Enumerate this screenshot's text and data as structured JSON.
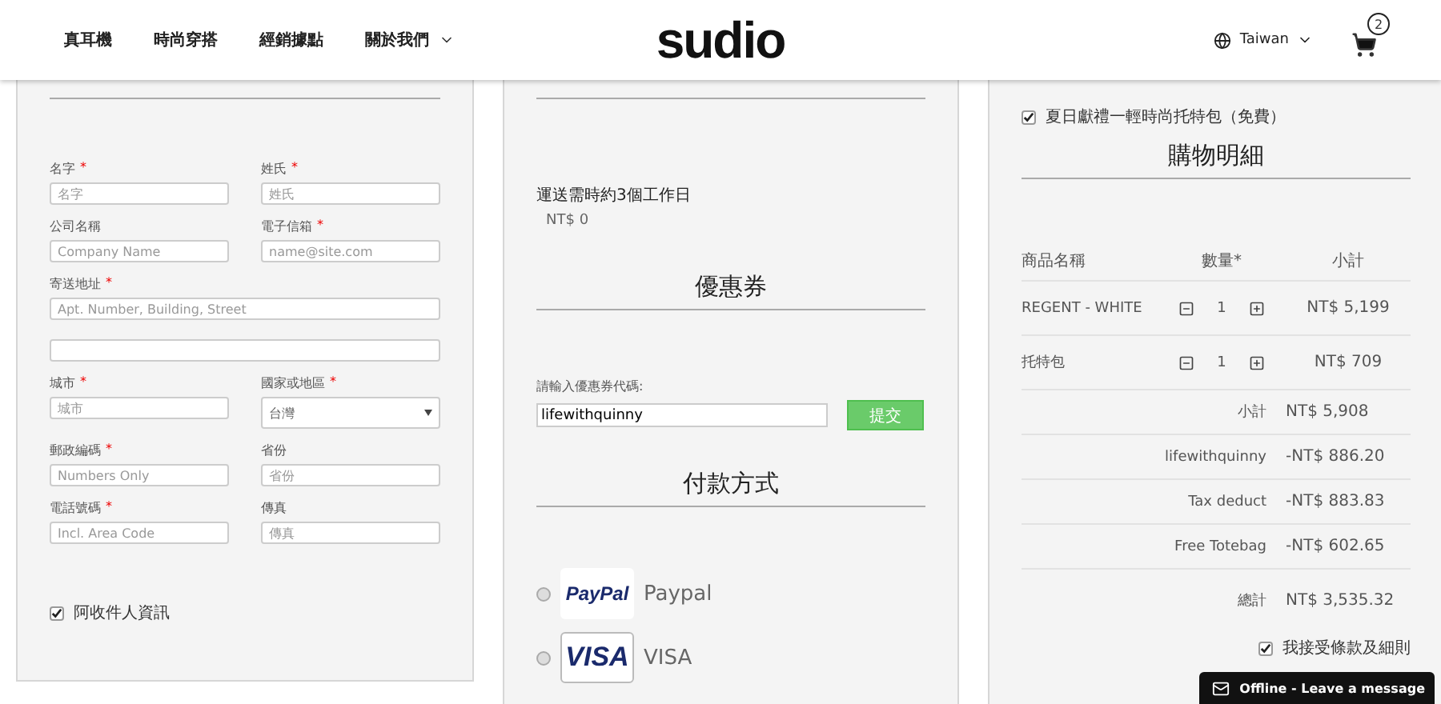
{
  "header": {
    "nav": [
      {
        "label": "真耳機",
        "dropdown": false
      },
      {
        "label": "時尚穿搭",
        "dropdown": false
      },
      {
        "label": "經銷據點",
        "dropdown": false
      },
      {
        "label": "關於我們",
        "dropdown": true
      }
    ],
    "logo": "sudio",
    "region": "Taiwan",
    "cart_count": "2"
  },
  "customer_form": {
    "fields": [
      {
        "kind": "input",
        "label": "名字",
        "marker": "*",
        "placeholder": "名字"
      },
      {
        "kind": "input",
        "label": "姓氏",
        "marker": "*",
        "placeholder": "姓氏"
      },
      {
        "kind": "input",
        "label": "公司名稱",
        "placeholder": "Company Name"
      },
      {
        "kind": "input",
        "label": "電子信箱",
        "marker": "*",
        "placeholder": "name@site.com"
      },
      {
        "kind": "wide",
        "label": "寄送地址",
        "marker": "*",
        "placeholder": "Apt. Number, Building, Street"
      },
      {
        "kind": "wide"
      },
      {
        "kind": "input",
        "label": "城市",
        "marker": "*",
        "placeholder": "城市"
      },
      {
        "kind": "select",
        "label": "國家或地區",
        "marker": "*",
        "value": "台灣"
      },
      {
        "kind": "input",
        "label": "郵政編碼",
        "marker": "*",
        "placeholder": "Numbers Only"
      },
      {
        "kind": "input",
        "label": "省份",
        "placeholder": "省份"
      },
      {
        "kind": "input",
        "label": "電話號碼",
        "marker": "*",
        "placeholder": "Incl. Area Code"
      },
      {
        "kind": "input",
        "label": "傳真",
        "placeholder": "傳真"
      }
    ],
    "same_as_recipient": {
      "label": "阿收件人資訊",
      "checked": true
    }
  },
  "shipping": {
    "note": "運送需時約3個工作日",
    "price": "NT$ 0"
  },
  "coupon": {
    "title": "優惠券",
    "label": "請輸入優惠券代碼:",
    "value": "lifewithquinny",
    "button": "提交"
  },
  "payment": {
    "title": "付款方式",
    "methods": [
      {
        "logo": "PayPal",
        "label": "Paypal",
        "kind": "paypal",
        "selected": false
      },
      {
        "logo": "VISA",
        "label": "VISA",
        "kind": "visa",
        "selected": false
      }
    ]
  },
  "order": {
    "gift": {
      "label": "夏日獻禮一輕時尚托特包（免費）",
      "checked": true
    },
    "title": "購物明細",
    "columns": [
      "商品名稱",
      "數量*",
      "小計"
    ],
    "items": [
      {
        "name": "REGENT - WHITE",
        "qty": "1",
        "subtotal": "NT$ 5,199"
      },
      {
        "name": "托特包",
        "qty": "1",
        "subtotal": "NT$ 709"
      }
    ],
    "totals": [
      {
        "label": "小計",
        "value": "NT$ 5,908"
      },
      {
        "label": "lifewithquinny",
        "value": "-NT$ 886.20"
      },
      {
        "label": "Tax deduct",
        "value": "-NT$ 883.83"
      },
      {
        "label": "Free Totebag",
        "value": "-NT$ 602.65"
      },
      {
        "label": "總計",
        "value": "NT$ 3,535.32"
      }
    ],
    "terms": {
      "label": "我接受條款及細則",
      "checked": true
    }
  },
  "chat": {
    "label": "Offline - Leave a message"
  }
}
